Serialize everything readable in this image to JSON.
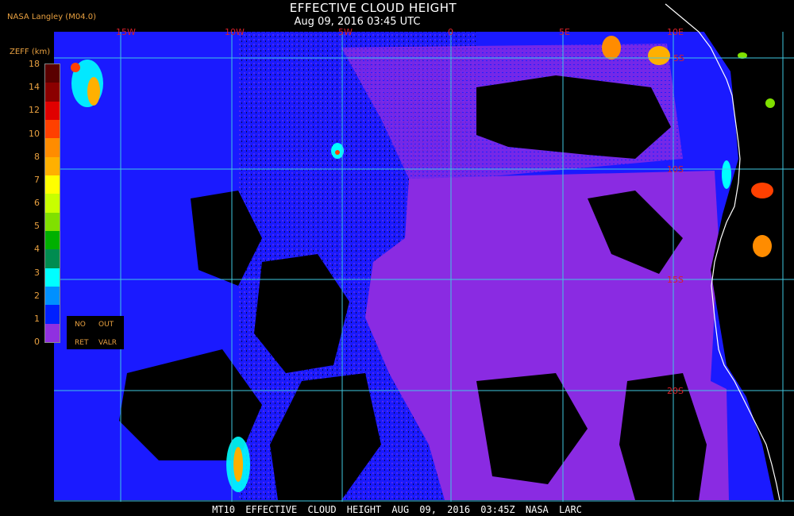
{
  "header": {
    "title": "EFFECTIVE CLOUD HEIGHT",
    "subtitle": "Aug 09, 2016 03:45 UTC",
    "producer": "NASA Langley (M04.0)"
  },
  "footer": {
    "text": "MT10  EFFECTIVE CLOUD HEIGHT  AUG 09, 2016 03:45Z  NASA LARC"
  },
  "map": {
    "longitude_labels": [
      "15W",
      "10W",
      "5W",
      "0",
      "5E",
      "10E"
    ],
    "latitude_labels": [
      "5S",
      "10S",
      "15S",
      "20S"
    ],
    "colors": {
      "grid": "#40c8e0",
      "coast": "#ffffff",
      "label": "#d8202a",
      "no_cloud": "#000000",
      "low_cloud_purple": "#8a2be2",
      "mid_cloud_blue": "#1a1aff"
    }
  },
  "legend": {
    "title": "ZEFF (km)",
    "ticks": [
      "18",
      "14",
      "12",
      "10",
      "8",
      "7",
      "6",
      "5",
      "4",
      "3",
      "2",
      "1",
      "0"
    ],
    "colors": [
      "#5a0000",
      "#8b0000",
      "#e00000",
      "#ff4000",
      "#ff8c00",
      "#ffb000",
      "#ffff00",
      "#c8ff00",
      "#80e000",
      "#00b000",
      "#008c50",
      "#00ffff",
      "#0090ff",
      "#0020ff",
      "#9030e0"
    ],
    "no_label": "NO",
    "ret_label": "RET",
    "out_label": "OUT",
    "valr_label": "VALR"
  }
}
